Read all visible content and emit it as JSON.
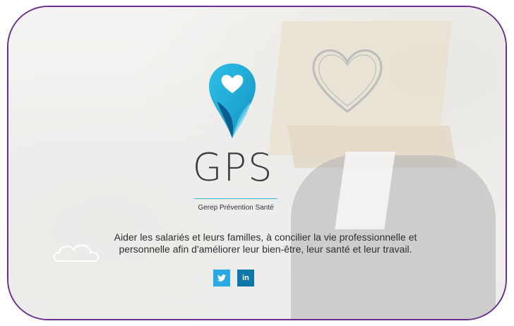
{
  "logo": {
    "text": "GPS",
    "subtitle": "Gerep Prévention Santé"
  },
  "tagline": {
    "line1": "Aider les salariés et leurs familles, à concilier la vie professionnelle et",
    "line2": "personnelle afin d'améliorer leur bien-être, leur santé et leur travail."
  },
  "social": {
    "twitter_icon": "twitter-icon",
    "linkedin_label": "in"
  },
  "colors": {
    "frame_border": "#6a2d91",
    "logo_teal": "#1aa6d0",
    "logo_dark": "#0b5c8a",
    "twitter": "#29a9e1",
    "linkedin": "#0e76a8"
  }
}
